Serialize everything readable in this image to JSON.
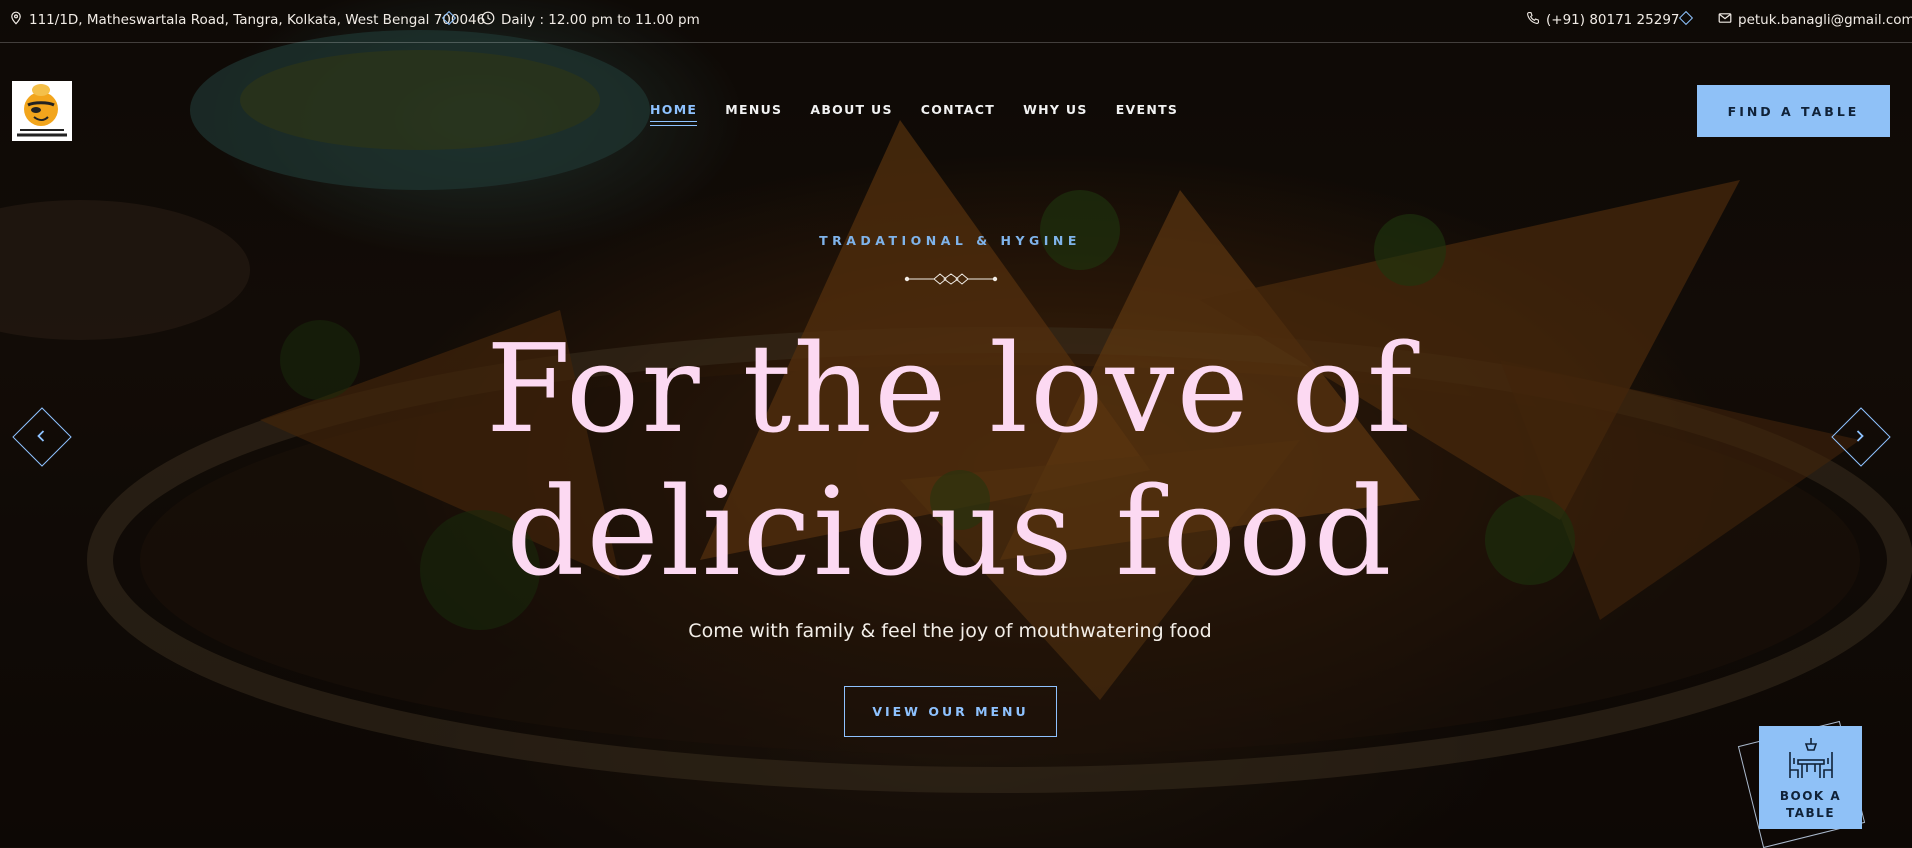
{
  "topbar": {
    "address": "111/1D, Matheswartala Road, Tangra, Kolkata, West Bengal 700046",
    "hours": "Daily : 12.00 pm to 11.00 pm",
    "phone": "(+91) 80171 25297",
    "email": "petuk.banagli@gmail.com"
  },
  "nav": {
    "items": [
      "HOME",
      "MENUS",
      "ABOUT US",
      "CONTACT",
      "WHY US",
      "EVENTS"
    ],
    "active": "HOME",
    "cta": "FIND A TABLE"
  },
  "hero": {
    "subtitle": "TRADATIONAL & HYGINE",
    "headline_line1": "For the love of",
    "headline_line2": "delicious food",
    "tagline": "Come with family & feel the joy of mouthwatering food",
    "button": "VIEW OUR MENU"
  },
  "book": {
    "line1": "BOOK A",
    "line2": "TABLE"
  },
  "icons": {
    "topbar": [
      "map-pin-icon",
      "clock-icon",
      "phone-icon",
      "mail-icon"
    ],
    "arrows": [
      "chevron-left-icon",
      "chevron-right-icon"
    ],
    "book": "dining-table-icon"
  },
  "colors": {
    "accent": "#8fc1f7",
    "headline": "#fcd9f2"
  }
}
